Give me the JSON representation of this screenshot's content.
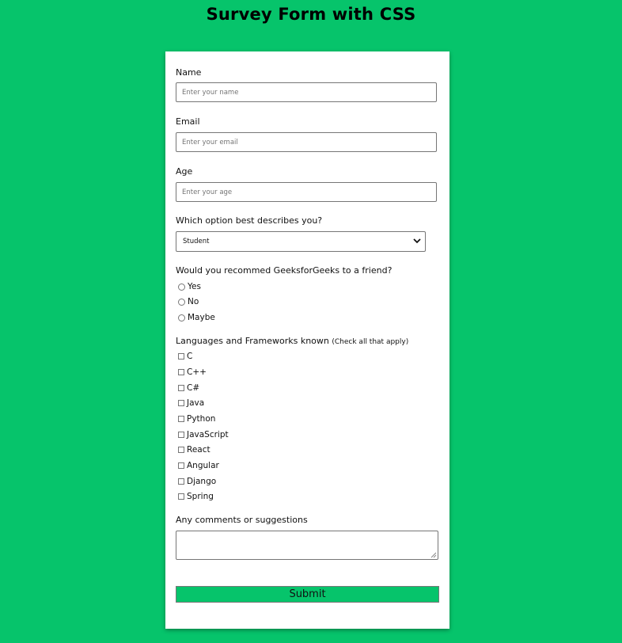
{
  "page": {
    "title": "Survey Form with CSS",
    "background_color": "#06c46b"
  },
  "form": {
    "name": {
      "label": "Name",
      "placeholder": "Enter your name"
    },
    "email": {
      "label": "Email",
      "placeholder": "Enter your email"
    },
    "age": {
      "label": "Age",
      "placeholder": "Enter your age"
    },
    "role": {
      "label": "Which option best describes you?",
      "selected": "Student",
      "icon": "chevron-down-icon"
    },
    "recommend": {
      "label": "Would you recommed GeeksforGeeks to a friend?",
      "options": [
        "Yes",
        "No",
        "Maybe"
      ]
    },
    "languages": {
      "label": "Languages and Frameworks known",
      "hint": "(Check all that apply)",
      "options": [
        "C",
        "C++",
        "C#",
        "Java",
        "Python",
        "JavaScript",
        "React",
        "Angular",
        "Django",
        "Spring"
      ]
    },
    "comments": {
      "label": "Any comments or suggestions",
      "value": ""
    },
    "submit_label": "Submit",
    "submit_color": "#06c46b"
  }
}
